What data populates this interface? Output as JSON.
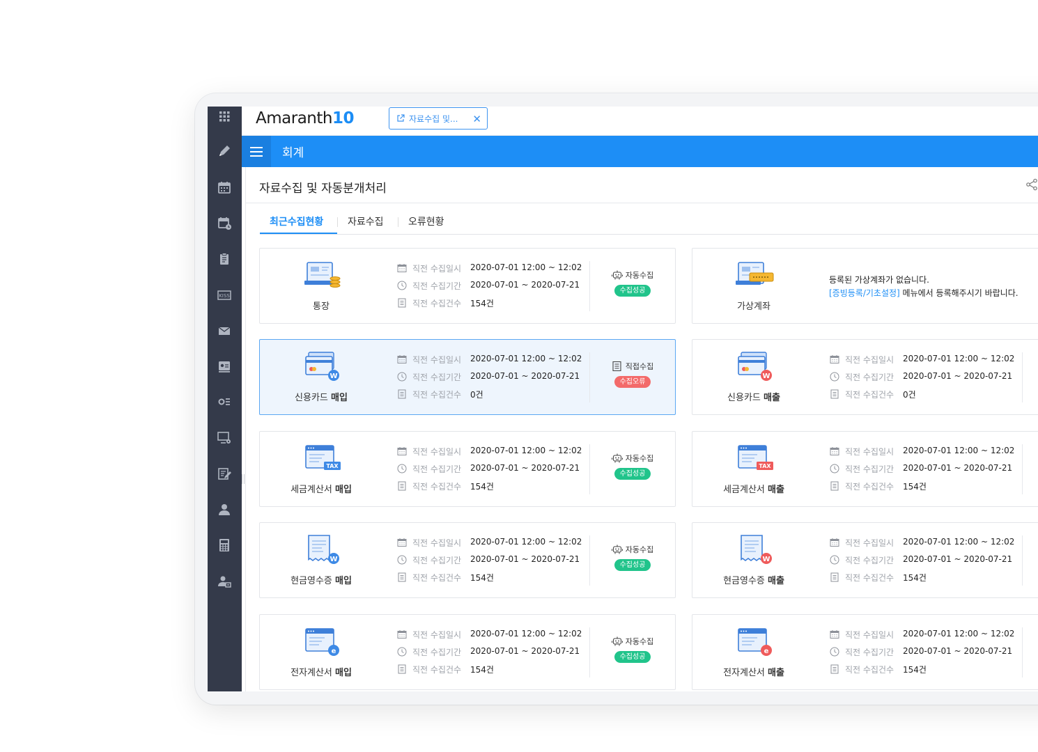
{
  "app": {
    "logo_text": "Amaranth",
    "logo_num": "10",
    "doc_tab_label": "자료수집 및...",
    "module_title": "회계",
    "page_title": "자료수집 및 자동분개처리"
  },
  "tabs": [
    {
      "label": "최근수집현황",
      "active": true
    },
    {
      "label": "자료수집",
      "active": false
    },
    {
      "label": "오류현황",
      "active": false
    }
  ],
  "labels": {
    "date_label": "직전 수집일시",
    "period_label": "직전 수집기간",
    "count_label": "직전 수집건수"
  },
  "cards": [
    {
      "name_pre": "통장",
      "name_bold": "",
      "icon": "bankbook-icon",
      "date": "2020-07-01   12:00 ~ 12:02",
      "period": "2020-07-01 ~ 2020-07-21",
      "count": "154건",
      "method": "자동수집",
      "status": "수집성공",
      "state": "ok"
    },
    {
      "name_pre": "가상계좌",
      "name_bold": "",
      "icon": "virtual-account-icon",
      "note_line1": "등록된 가상계좌가 없습니다.",
      "note_link": "[증빙등록/기초설정]",
      "note_line2": " 메뉴에서 등록해주시기 바랍니다."
    },
    {
      "name_pre": "신용카드 ",
      "name_bold": "매입",
      "icon": "credit-card-purchase-icon",
      "date": "2020-07-01   12:00 ~ 12:02",
      "period": "2020-07-01 ~ 2020-07-21",
      "count": "0건",
      "method": "직접수집",
      "status": "수집오류",
      "state": "err",
      "selected": true
    },
    {
      "name_pre": "신용카드 ",
      "name_bold": "매출",
      "icon": "credit-card-sales-icon",
      "date": "2020-07-01   12:00 ~ 12:02",
      "period": "2020-07-01 ~ 2020-07-21",
      "count": "0건"
    },
    {
      "name_pre": "세금계산서 ",
      "name_bold": "매입",
      "icon": "tax-invoice-purchase-icon",
      "date": "2020-07-01   12:00 ~ 12:02",
      "period": "2020-07-01 ~ 2020-07-21",
      "count": "154건",
      "method": "자동수집",
      "status": "수집성공",
      "state": "ok"
    },
    {
      "name_pre": "세금계산서 ",
      "name_bold": "매출",
      "icon": "tax-invoice-sales-icon",
      "date": "2020-07-01   12:00 ~ 12:02",
      "period": "2020-07-01 ~ 2020-07-21",
      "count": "154건"
    },
    {
      "name_pre": "현금영수증 ",
      "name_bold": "매입",
      "icon": "cash-receipt-purchase-icon",
      "date": "2020-07-01   12:00 ~ 12:02",
      "period": "2020-07-01 ~ 2020-07-21",
      "count": "154건",
      "method": "자동수집",
      "status": "수집성공",
      "state": "ok"
    },
    {
      "name_pre": "현금영수증 ",
      "name_bold": "매출",
      "icon": "cash-receipt-sales-icon",
      "date": "2020-07-01   12:00 ~ 12:02",
      "period": "2020-07-01 ~ 2020-07-21",
      "count": "154건"
    },
    {
      "name_pre": "전자계산서 ",
      "name_bold": "매입",
      "icon": "e-invoice-purchase-icon",
      "date": "2020-07-01   12:00 ~ 12:02",
      "period": "2020-07-01 ~ 2020-07-21",
      "count": "154건",
      "method": "자동수집",
      "status": "수집성공",
      "state": "ok"
    },
    {
      "name_pre": "전자계산서 ",
      "name_bold": "매출",
      "icon": "e-invoice-sales-icon",
      "date": "2020-07-01   12:00 ~ 12:02",
      "period": "2020-07-01 ~ 2020-07-21",
      "count": "154건"
    }
  ],
  "sidebar_icons": [
    "apps-grid-icon",
    "pen-icon",
    "calendar-icon",
    "schedule-icon",
    "clipboard-icon",
    "kiss-icon",
    "mail-icon",
    "id-card-icon",
    "settings-list-icon",
    "monitor-gear-icon",
    "edit-doc-icon",
    "person-icon",
    "calculator-icon",
    "user-admin-icon"
  ],
  "colors": {
    "accent": "#1d8ef6",
    "success": "#21c48b",
    "error": "#f36a6a",
    "sidebar": "#343a4a"
  }
}
